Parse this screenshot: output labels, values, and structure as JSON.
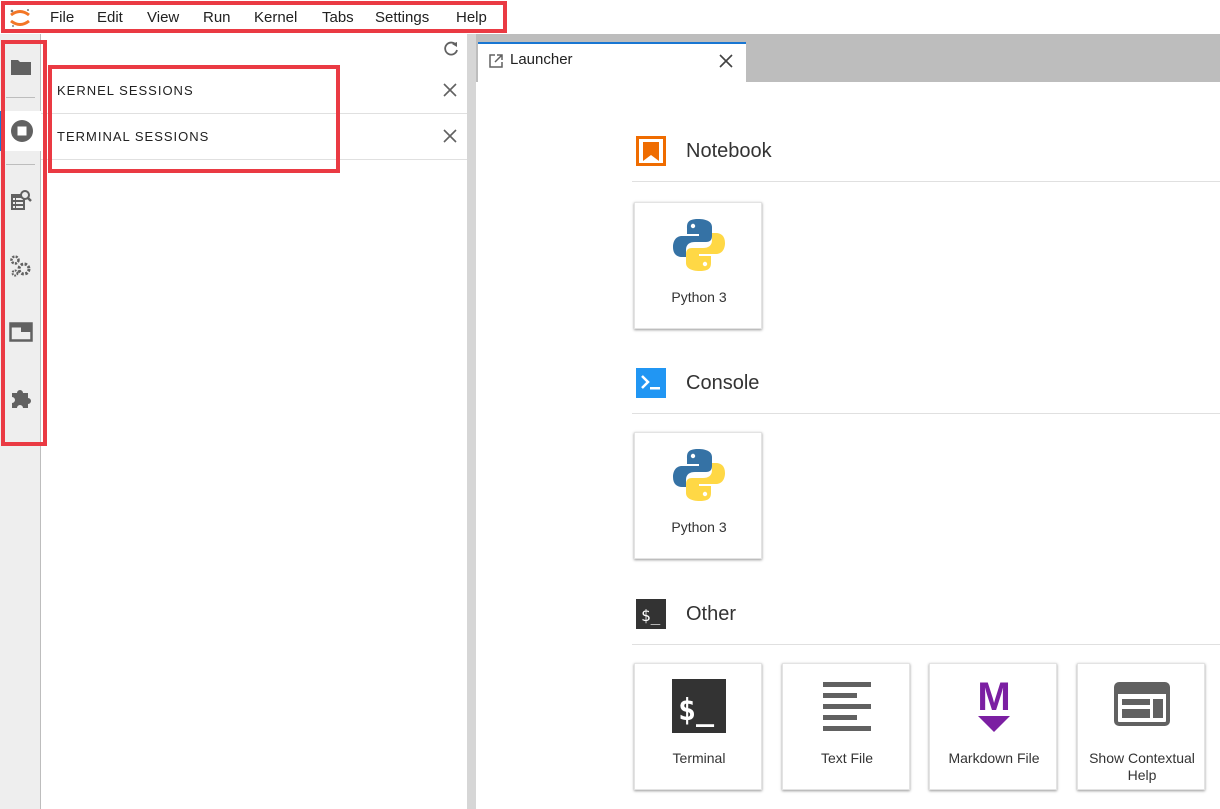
{
  "menubar": {
    "items": [
      "File",
      "Edit",
      "View",
      "Run",
      "Kernel",
      "Tabs",
      "Settings",
      "Help"
    ]
  },
  "activitybar": {
    "items": [
      {
        "icon": "folder-icon"
      },
      {
        "icon": "running-sessions-icon"
      },
      {
        "icon": "property-inspector-icon"
      },
      {
        "icon": "commands-icon"
      },
      {
        "icon": "tabs-icon"
      },
      {
        "icon": "extension-icon"
      }
    ]
  },
  "sidepanel": {
    "sections": [
      {
        "title": "KERNEL SESSIONS"
      },
      {
        "title": "TERMINAL SESSIONS"
      }
    ]
  },
  "tabs": [
    {
      "label": "Launcher"
    }
  ],
  "launcher": {
    "categories": [
      {
        "title": "Notebook",
        "cards": [
          {
            "label": "Python 3"
          }
        ]
      },
      {
        "title": "Console",
        "cards": [
          {
            "label": "Python 3"
          }
        ]
      },
      {
        "title": "Other",
        "cards": [
          {
            "label": "Terminal"
          },
          {
            "label": "Text File"
          },
          {
            "label": "Markdown File"
          },
          {
            "label": "Show Contextual Help"
          }
        ]
      }
    ]
  },
  "colors": {
    "highlight": "#ea3a43",
    "accent": "#1976d2",
    "notebook": "#ef6c00",
    "console": "#2196f3",
    "markdown": "#7b1fa2"
  }
}
